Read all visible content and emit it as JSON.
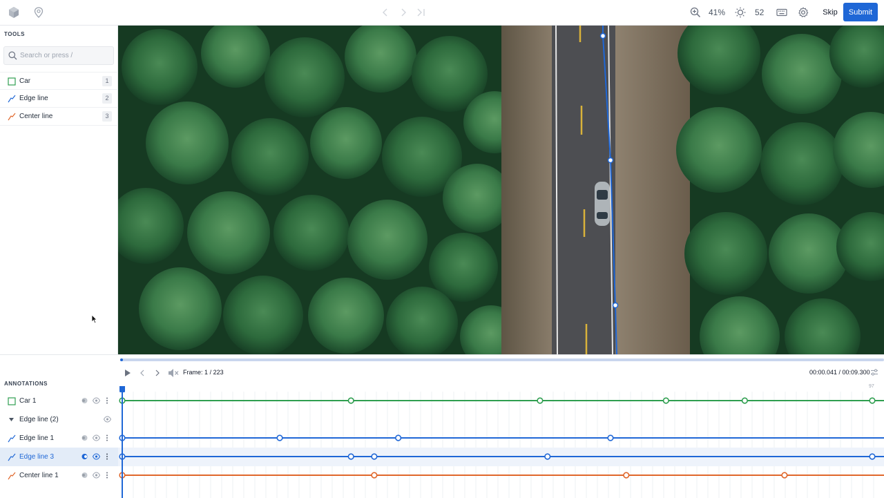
{
  "toolbar": {
    "zoom": "41%",
    "brightness": "52",
    "skip_label": "Skip",
    "submit_label": "Submit"
  },
  "tools": {
    "title": "TOOLS",
    "search_placeholder": "Search or press /",
    "items": [
      {
        "label": "Car",
        "key": "1",
        "color": "#2e9e4f"
      },
      {
        "label": "Edge line",
        "key": "2",
        "color": "#1f67d6"
      },
      {
        "label": "Center line",
        "key": "3",
        "color": "#e0662a"
      }
    ]
  },
  "player": {
    "frame_label": "Frame:",
    "frame_value": "1",
    "frame_total": "/ 223",
    "time": "00:00.041 / 00:09.300",
    "progress": 0.004,
    "right_frame_number": "97"
  },
  "annotations": {
    "title": "ANNOTATIONS",
    "rows": [
      {
        "label": "Car 1",
        "type": "box",
        "color": "#2e9e4f",
        "selected": false,
        "keyframes": [
          0,
          0.305,
          0.557,
          0.725,
          0.83,
          1.0
        ]
      },
      {
        "label": "Edge line (2)",
        "type": "group",
        "color": "#6b7280",
        "selected": false,
        "keyframes": []
      },
      {
        "label": "Edge line 1",
        "type": "line",
        "color": "#1f67d6",
        "selected": false,
        "keyframes": [
          0,
          0.21,
          0.368,
          0.651
        ]
      },
      {
        "label": "Edge line 3",
        "type": "line",
        "color": "#1f67d6",
        "selected": true,
        "keyframes": [
          0,
          0.305,
          0.336,
          0.567,
          1.0
        ]
      },
      {
        "label": "Center line 1",
        "type": "line",
        "color": "#e0662a",
        "selected": false,
        "keyframes": [
          0,
          0.336,
          0.672,
          0.883
        ]
      }
    ]
  },
  "colors": {
    "accent": "#1f67d6",
    "car": "#2e9e4f",
    "edge": "#1f67d6",
    "center": "#e0662a"
  }
}
